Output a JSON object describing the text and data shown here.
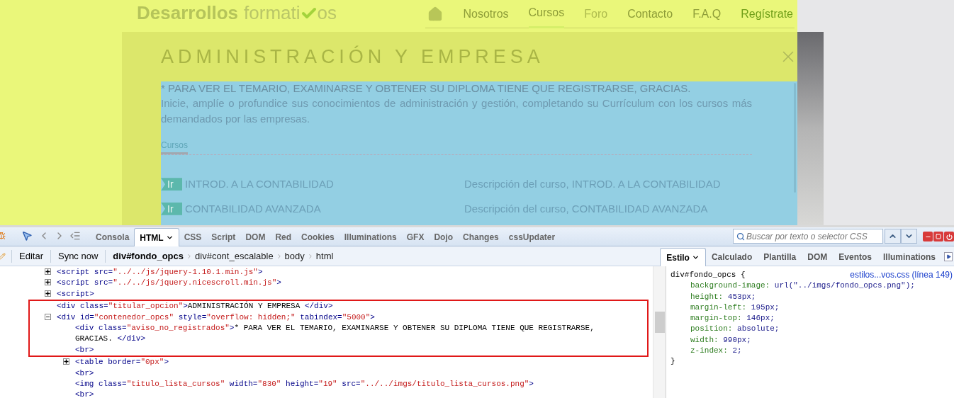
{
  "site": {
    "logo": {
      "bold": "Desarrollos",
      "light": "formati",
      "tail": "os"
    },
    "nav": [
      {
        "label": "Nosotros",
        "kind": "link",
        "selected": false
      },
      {
        "label": "Cursos",
        "kind": "link",
        "selected": true
      },
      {
        "label": "Foro",
        "kind": "muted",
        "selected": false
      },
      {
        "label": "Contacto",
        "kind": "link",
        "selected": false
      },
      {
        "label": "F.A.Q",
        "kind": "link",
        "selected": false
      },
      {
        "label": "Regístrate",
        "kind": "accent",
        "selected": false
      }
    ],
    "modal": {
      "title": "ADMINISTRACIÓN Y EMPRESA",
      "notice": "* PARA VER EL TEMARIO, EXAMINARSE Y OBTENER SU DIPLOMA TIENE QUE REGISTRARSE, GRACIAS.",
      "intro": "Inicie, amplíe o profundice sus conocimientos de administración y gestión, completando su Currículum con los cursos más demandados por las empresas.",
      "tabs": [
        {
          "label": "Cursos",
          "selected": true
        }
      ],
      "courses": [
        {
          "button": "Ir",
          "name": "INTROD. A LA CONTABILIDAD",
          "description": "Descripción del curso, INTROD. A LA CONTABILIDAD"
        },
        {
          "button": "Ir",
          "name": "CONTABILIDAD AVANZADA",
          "description": "Descripción del curso, CONTABILIDAD AVANZADA"
        }
      ]
    }
  },
  "devtools": {
    "panels": [
      {
        "label": "Consola",
        "selected": false
      },
      {
        "label": "HTML",
        "selected": true
      },
      {
        "label": "CSS",
        "selected": false
      },
      {
        "label": "Script",
        "selected": false
      },
      {
        "label": "DOM",
        "selected": false
      },
      {
        "label": "Red",
        "selected": false
      },
      {
        "label": "Cookies",
        "selected": false
      },
      {
        "label": "Illuminations",
        "selected": false
      },
      {
        "label": "GFX",
        "selected": false
      },
      {
        "label": "Dojo",
        "selected": false
      },
      {
        "label": "Changes",
        "selected": false
      },
      {
        "label": "cssUpdater",
        "selected": false
      }
    ],
    "search": {
      "placeholder": "Buscar por texto o selector CSS"
    },
    "toolbar": [
      "Editar",
      "Sync now"
    ],
    "breadcrumbs": [
      {
        "label": "div#fondo_opcs",
        "selected": true
      },
      {
        "label": "div#cont_escalable",
        "selected": false
      },
      {
        "label": "body",
        "selected": false
      },
      {
        "label": "html",
        "selected": false
      }
    ],
    "side_tabs": [
      {
        "label": "Estilo",
        "selected": true
      },
      {
        "label": "Calculado",
        "selected": false
      },
      {
        "label": "Plantilla",
        "selected": false
      },
      {
        "label": "DOM",
        "selected": false
      },
      {
        "label": "Eventos",
        "selected": false
      },
      {
        "label": "Illuminations",
        "selected": false
      }
    ],
    "html_tree": [
      {
        "expandable": true,
        "expanded": false,
        "highlighted": false,
        "parts": [
          {
            "kind": "tag",
            "text": "<script"
          },
          {
            "kind": "attr",
            "text": " src="
          },
          {
            "kind": "value",
            "text": "\"../../js/jquery-1.10.1.min.js\""
          },
          {
            "kind": "tag",
            "text": ">"
          }
        ]
      },
      {
        "expandable": true,
        "expanded": false,
        "highlighted": false,
        "parts": [
          {
            "kind": "tag",
            "text": "<script"
          },
          {
            "kind": "attr",
            "text": " src="
          },
          {
            "kind": "value",
            "text": "\"../../js/jquery.nicescroll.min.js\""
          },
          {
            "kind": "tag",
            "text": ">"
          }
        ]
      },
      {
        "expandable": true,
        "expanded": false,
        "highlighted": false,
        "parts": [
          {
            "kind": "tag",
            "text": "<script>"
          }
        ]
      },
      {
        "expandable": false,
        "highlighted": true,
        "parts": [
          {
            "kind": "tag",
            "text": "<div"
          },
          {
            "kind": "attr",
            "text": " class="
          },
          {
            "kind": "value",
            "text": "\"titular_opcion\""
          },
          {
            "kind": "tag",
            "text": ">"
          },
          {
            "kind": "text",
            "text": "ADMINISTRACIÓN Y EMPRESA "
          },
          {
            "kind": "tag",
            "text": "</div>"
          }
        ]
      },
      {
        "expandable": true,
        "expanded": true,
        "highlighted": true,
        "parts": [
          {
            "kind": "tag",
            "text": "<div"
          },
          {
            "kind": "attr",
            "text": " id="
          },
          {
            "kind": "value",
            "text": "\"contenedor_opcs\""
          },
          {
            "kind": "attr",
            "text": " style="
          },
          {
            "kind": "value",
            "text": "\"overflow: hidden;\""
          },
          {
            "kind": "attr",
            "text": " tabindex="
          },
          {
            "kind": "value",
            "text": "\"5000\""
          },
          {
            "kind": "tag",
            "text": ">"
          }
        ],
        "children": [
          {
            "expandable": false,
            "highlighted": true,
            "parts": [
              {
                "kind": "tag",
                "text": "<div"
              },
              {
                "kind": "attr",
                "text": " class="
              },
              {
                "kind": "value",
                "text": "\"aviso_no_registrados\""
              },
              {
                "kind": "tag",
                "text": ">"
              },
              {
                "kind": "text",
                "text": "* PARA VER EL TEMARIO, EXAMINARSE Y OBTENER SU DIPLOMA TIENE QUE REGISTRARSE, GRACIAS. "
              },
              {
                "kind": "tag",
                "text": "</div>"
              }
            ]
          },
          {
            "expandable": false,
            "highlighted": true,
            "parts": [
              {
                "kind": "tag",
                "text": "<br>"
              }
            ]
          },
          {
            "expandable": true,
            "expanded": false,
            "highlighted": false,
            "parts": [
              {
                "kind": "tag",
                "text": "<table"
              },
              {
                "kind": "attr",
                "text": " border="
              },
              {
                "kind": "value",
                "text": "\"0px\""
              },
              {
                "kind": "tag",
                "text": ">"
              }
            ]
          },
          {
            "expandable": false,
            "highlighted": false,
            "parts": [
              {
                "kind": "tag",
                "text": "<br>"
              }
            ]
          },
          {
            "expandable": false,
            "highlighted": false,
            "parts": [
              {
                "kind": "tag",
                "text": "<img"
              },
              {
                "kind": "attr",
                "text": " class="
              },
              {
                "kind": "value",
                "text": "\"titulo_lista_cursos\""
              },
              {
                "kind": "attr",
                "text": " width="
              },
              {
                "kind": "value",
                "text": "\"830\""
              },
              {
                "kind": "attr",
                "text": " height="
              },
              {
                "kind": "value",
                "text": "\"19\""
              },
              {
                "kind": "attr",
                "text": " src="
              },
              {
                "kind": "value",
                "text": "\"../../imgs/titulo_lista_cursos.png\""
              },
              {
                "kind": "tag",
                "text": ">"
              }
            ]
          },
          {
            "expandable": false,
            "highlighted": false,
            "parts": [
              {
                "kind": "tag",
                "text": "<br>"
              }
            ]
          }
        ]
      }
    ],
    "style_rule": {
      "selector": "div#fondo_opcs {",
      "source": "estilos...vos.css (línea 149)",
      "close": "}",
      "properties": [
        {
          "name": "background-image:",
          "value": "url(\"../imgs/fondo_opcs.png\");"
        },
        {
          "name": "height:",
          "value": "453px;"
        },
        {
          "name": "margin-left:",
          "value": "195px;"
        },
        {
          "name": "margin-top:",
          "value": "146px;"
        },
        {
          "name": "position:",
          "value": "absolute;"
        },
        {
          "name": "width:",
          "value": "990px;"
        },
        {
          "name": "z-index:",
          "value": "2;"
        }
      ]
    }
  }
}
